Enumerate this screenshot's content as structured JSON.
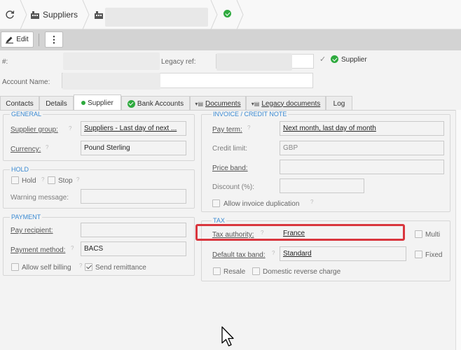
{
  "breadcrumb": {
    "suppliers_label": "Suppliers",
    "refresh_icon": "refresh-icon",
    "building_icon": "building-icon",
    "status_icon": "check-circle-icon"
  },
  "toolbar": {
    "edit_label": "Edit",
    "more_label": "⋮"
  },
  "header": {
    "number_label": "#:",
    "legacy_ref_label": "Legacy ref:",
    "supplier_check_label": "Supplier",
    "account_name_label": "Account Name:"
  },
  "tabs": [
    {
      "label": "Contacts"
    },
    {
      "label": "Details"
    },
    {
      "label": "Supplier"
    },
    {
      "label": "Bank Accounts"
    },
    {
      "label": "Documents"
    },
    {
      "label": "Legacy documents"
    },
    {
      "label": "Log"
    }
  ],
  "general": {
    "title": "GENERAL",
    "supplier_group_label": "Supplier group:",
    "supplier_group_value": "Suppliers - Last day of next ...",
    "currency_label": "Currency:",
    "currency_value": "Pound Sterling"
  },
  "hold": {
    "title": "HOLD",
    "hold_label": "Hold",
    "stop_label": "Stop",
    "warning_label": "Warning message:",
    "warning_value": ""
  },
  "payment": {
    "title": "PAYMENT",
    "recipient_label": "Pay recipient:",
    "recipient_value": "",
    "method_label": "Payment method:",
    "method_value": "BACS",
    "self_billing_label": "Allow self billing",
    "remittance_label": "Send remittance"
  },
  "invoice": {
    "title": "INVOICE / CREDIT NOTE",
    "pay_term_label": "Pay term:",
    "pay_term_value": "Next month, last day of month",
    "credit_limit_label": "Credit limit:",
    "credit_limit_value": "GBP",
    "price_band_label": "Price band:",
    "price_band_value": "",
    "discount_label": "Discount (%):",
    "discount_value": "",
    "duplication_label": "Allow invoice duplication"
  },
  "tax": {
    "title": "TAX",
    "authority_label": "Tax authority:",
    "authority_value": "France",
    "multi_label": "Multi",
    "default_band_label": "Default tax band:",
    "default_band_value": "Standard",
    "fixed_label": "Fixed",
    "resale_label": "Resale",
    "reverse_charge_label": "Domestic reverse charge"
  },
  "colors": {
    "accent": "#3a8ad3",
    "success": "#2eaa3e",
    "highlight": "#d9363e"
  }
}
